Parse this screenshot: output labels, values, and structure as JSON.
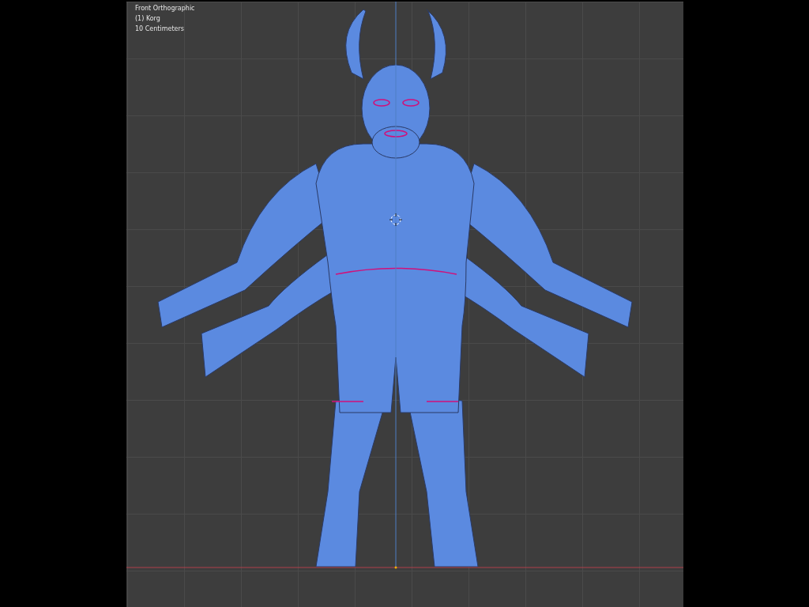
{
  "viewport": {
    "overlay": [
      "Front Orthographic",
      "(1) Korg",
      "10 Centimeters"
    ]
  }
}
